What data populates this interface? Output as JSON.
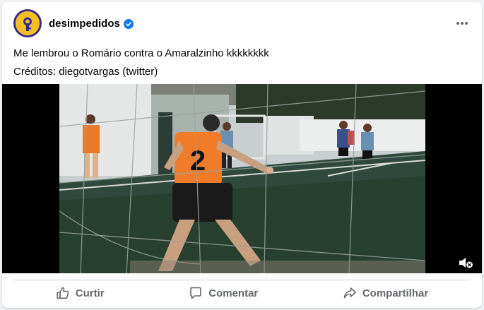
{
  "post": {
    "page_name": "desimpedidos",
    "verified": true,
    "caption_line1": "Me lembrou o Romário contra o Amaralzinho kkkkkkkk",
    "caption_line2": "Créditos: diegotvargas (twitter)",
    "avatar_icon": "desimpedidos-logo",
    "more_icon": "more-horizontal-icon"
  },
  "video": {
    "scene": "futsal-goalkeeper-video",
    "jersey_number": "2",
    "muted": true,
    "mute_icon": "speaker-muted-icon"
  },
  "actions": {
    "like_label": "Curtir",
    "comment_label": "Comentar",
    "share_label": "Compartilhar"
  },
  "colors": {
    "accent": "#1877f2",
    "secondary_text": "#65676b",
    "divider": "#ced0d4"
  }
}
